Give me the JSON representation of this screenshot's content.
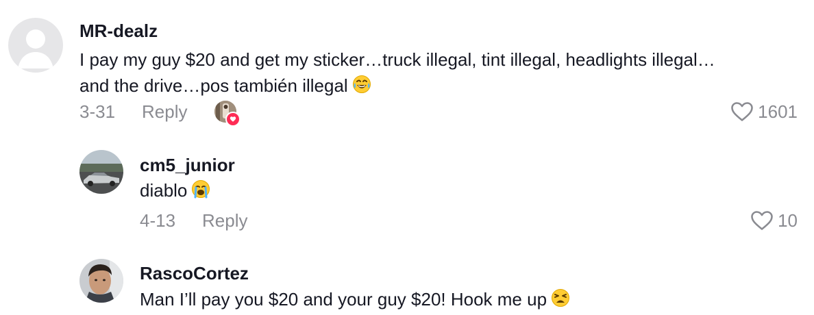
{
  "comments": [
    {
      "username": "MR-dealz",
      "text_line1": "I pay my guy $20 and get my sticker…truck illegal, tint illegal, headlights illegal…",
      "text_line2": "and the drive…pos también illegal",
      "emoji": "face-with-tears-of-joy",
      "date": "3-31",
      "reply_label": "Reply",
      "likes": "1601",
      "liked_by_creator": true
    },
    {
      "username": "cm5_junior",
      "text_line1": "diablo",
      "emoji": "loudly-crying-face",
      "date": "4-13",
      "reply_label": "Reply",
      "likes": "10"
    },
    {
      "username": "RascoCortez",
      "text_line1": "Man I’ll pay you $20 and your guy $20! Hook me up",
      "emoji": "weary-face"
    }
  ],
  "colors": {
    "text": "#161823",
    "muted": "#8a8b91",
    "like_badge": "#fe2c55"
  }
}
